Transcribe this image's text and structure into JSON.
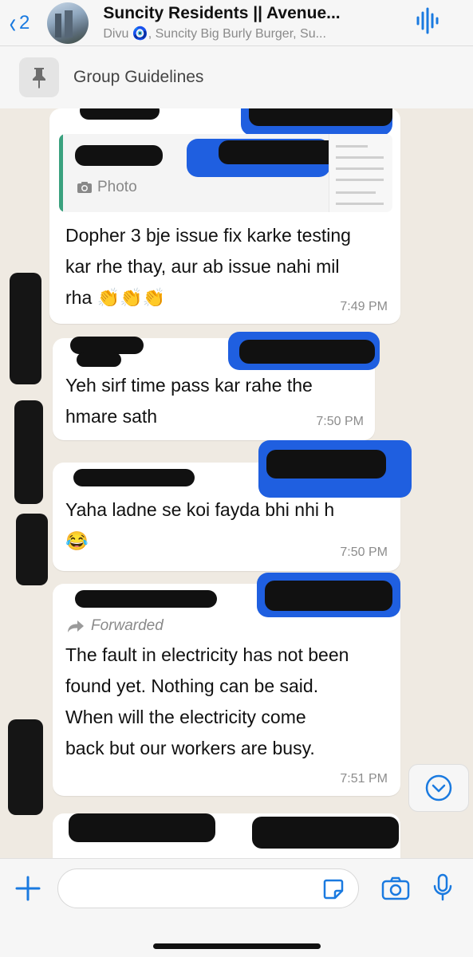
{
  "header": {
    "back_count": "2",
    "group_title": "Suncity Residents || Avenue...",
    "group_subtitle": "Divu 🧿, Suncity Big Burly Burger, Su..."
  },
  "pinned": {
    "label": "Group Guidelines"
  },
  "messages": [
    {
      "quote_type": "Photo",
      "text_lines": [
        "Dopher 3 bje issue fix karke testing",
        "kar rhe thay, aur ab issue nahi mil",
        "rha 👏👏👏"
      ],
      "time": "7:49 PM"
    },
    {
      "text_lines": [
        "Yeh sirf time pass kar rahe the",
        "hmare sath"
      ],
      "time": "7:50 PM"
    },
    {
      "text_lines": [
        "Yaha ladne se koi fayda bhi nhi h",
        "😂"
      ],
      "time": "7:50 PM"
    },
    {
      "forwarded_label": "Forwarded",
      "text_lines": [
        "The fault in electricity has not been",
        "found yet. Nothing can be said.",
        "When will the electricity come",
        "back but our workers are busy."
      ],
      "time": "7:51 PM"
    }
  ],
  "icons": {
    "back": "chevron-left-icon",
    "audio": "waveform-icon",
    "pin": "pin-icon",
    "photo": "camera-icon",
    "forward": "forward-arrow-icon",
    "scroll": "chevron-down-circle-icon",
    "attach": "plus-icon",
    "sticker": "sticker-icon",
    "camera": "camera-icon",
    "mic": "microphone-icon"
  },
  "colors": {
    "accent": "#1a7ae0",
    "sender": "#3aa17e",
    "bubble": "#ffffff",
    "background": "#efeae2"
  }
}
